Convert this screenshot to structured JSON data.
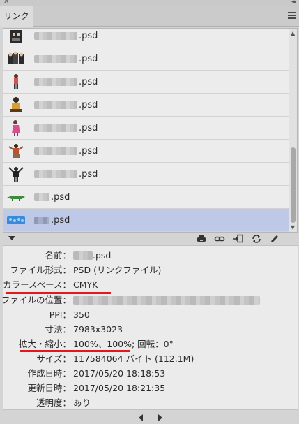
{
  "window": {
    "close_glyph": "✕",
    "collapse_glyph": "◂◂"
  },
  "panel": {
    "tab_label": "リンク",
    "menu_icon": "panel-menu-icon"
  },
  "links": [
    {
      "name_suffix": ".psd",
      "thumb": "figure-group",
      "blur_width": 62
    },
    {
      "name_suffix": ".psd",
      "thumb": "figure-group",
      "blur_width": 62
    },
    {
      "name_suffix": ".psd",
      "thumb": "figure-standing",
      "blur_width": 62
    },
    {
      "name_suffix": ".psd",
      "thumb": "figure-seated",
      "blur_width": 62
    },
    {
      "name_suffix": ".psd",
      "thumb": "figure-pink",
      "blur_width": 62
    },
    {
      "name_suffix": ".psd",
      "thumb": "figure-dancer",
      "blur_width": 62
    },
    {
      "name_suffix": ".psd",
      "thumb": "figure-arms-up",
      "blur_width": 62
    },
    {
      "name_suffix": ".psd",
      "thumb": "crocodile",
      "blur_width": 22
    },
    {
      "name_suffix": ".psd",
      "thumb": "blue-pattern",
      "blur_width": 22,
      "selected": true
    }
  ],
  "toolbar": {
    "icons": [
      "cloud-link-icon",
      "relink-icon",
      "goto-link-icon",
      "update-link-icon",
      "edit-original-icon"
    ]
  },
  "info": {
    "name_label": "名前：",
    "name_suffix": ".psd",
    "format_label": "ファイル形式：",
    "format_value": "PSD (リンクファイル)",
    "colorspace_label": "カラースペース：",
    "colorspace_value": "CMYK",
    "location_label": "ファイルの位置：",
    "ppi_label": "PPI：",
    "ppi_value": "350",
    "dimensions_label": "寸法：",
    "dimensions_value": "7983x3023",
    "scale_label": "拡大・縮小：",
    "scale_value": "100%、100%",
    "rotation_value": "; 回転：0°",
    "size_label": "サイズ：",
    "size_value": "117584064 バイト (112.1M)",
    "created_label": "作成日時：",
    "created_value": "2017/05/20 18:18:53",
    "modified_label": "更新日時：",
    "modified_value": "2017/05/20 18:21:35",
    "transparency_label": "透明度：",
    "transparency_value": "あり"
  },
  "annotation_color": "#e2181c",
  "selection_color": "#bdc9e6"
}
